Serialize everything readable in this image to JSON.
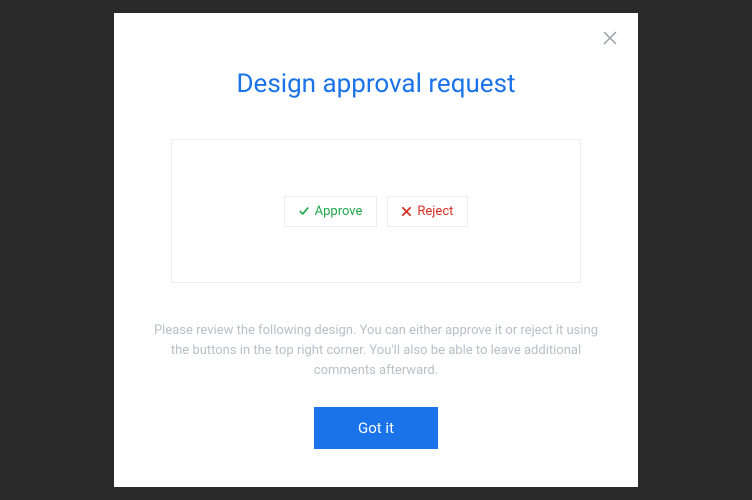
{
  "modal": {
    "title": "Design approval request",
    "description": "Please review the following design. You can either approve it or reject it using the buttons in the top right corner. You'll also be able to leave additional comments afterward.",
    "approve_label": "Approve",
    "reject_label": "Reject",
    "confirm_label": "Got it"
  }
}
